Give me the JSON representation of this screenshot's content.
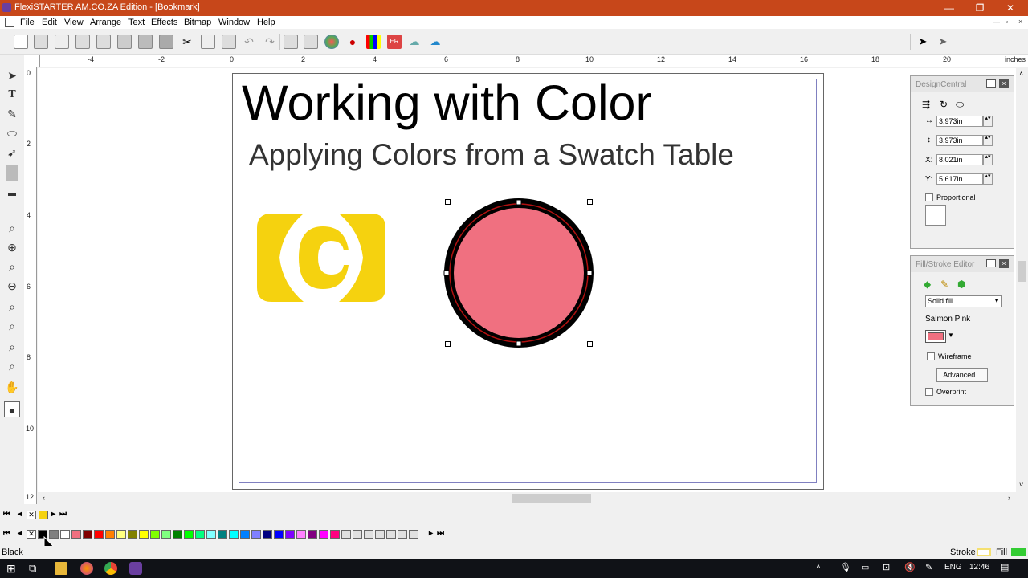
{
  "window": {
    "title": "FlexiSTARTER AM.CO.ZA Edition - [Bookmark]",
    "buttons": [
      "—",
      "❐",
      "✕"
    ]
  },
  "menu": [
    "File",
    "Edit",
    "View",
    "Arrange",
    "Text",
    "Effects",
    "Bitmap",
    "Window",
    "Help"
  ],
  "doc_controls": [
    "—",
    "▫",
    "×"
  ],
  "ruler": {
    "unit": "inches",
    "h_labels": [
      "-4",
      "-2",
      "0",
      "2",
      "4",
      "6",
      "8",
      "10",
      "12",
      "14",
      "16",
      "18",
      "20"
    ],
    "v_labels": [
      "0",
      "2",
      "4",
      "6",
      "8",
      "10",
      "12"
    ]
  },
  "document": {
    "heading": "Working with Color",
    "subheading": "Applying Colors from a Swatch Table",
    "circle_fill": "#f07080",
    "circle_stroke": "#000000",
    "logo_color": "#f5d20f"
  },
  "design_central": {
    "title": "DesignCentral",
    "width": "3,973in",
    "height": "3,973in",
    "x_label": "X:",
    "x": "8,021in",
    "y_label": "Y:",
    "y": "5,617in",
    "proportional": "Proportional"
  },
  "fill_stroke": {
    "title": "Fill/Stroke Editor",
    "fill_type": "Solid fill",
    "color_name": "Salmon Pink",
    "wireframe": "Wireframe",
    "advanced": "Advanced...",
    "overprint": "Overprint"
  },
  "status": {
    "left": "Black",
    "stroke": "Stroke",
    "fill": "Fill"
  },
  "taskbar": {
    "lang": "ENG",
    "time": "12:46"
  },
  "swatches": [
    "#000000",
    "#808080",
    "#ffffff",
    "#f07080",
    "#800000",
    "#ff0000",
    "#ff8000",
    "#ffff80",
    "#808000",
    "#ffff00",
    "#80ff00",
    "#80ff80",
    "#008000",
    "#00ff00",
    "#00ff80",
    "#80ffff",
    "#008080",
    "#00ffff",
    "#0080ff",
    "#8080ff",
    "#000080",
    "#0000ff",
    "#8000ff",
    "#ff80ff",
    "#800080",
    "#ff00ff",
    "#ff0080"
  ],
  "colors": {
    "titlebar": "#c7471a",
    "accent": "#f07080"
  }
}
